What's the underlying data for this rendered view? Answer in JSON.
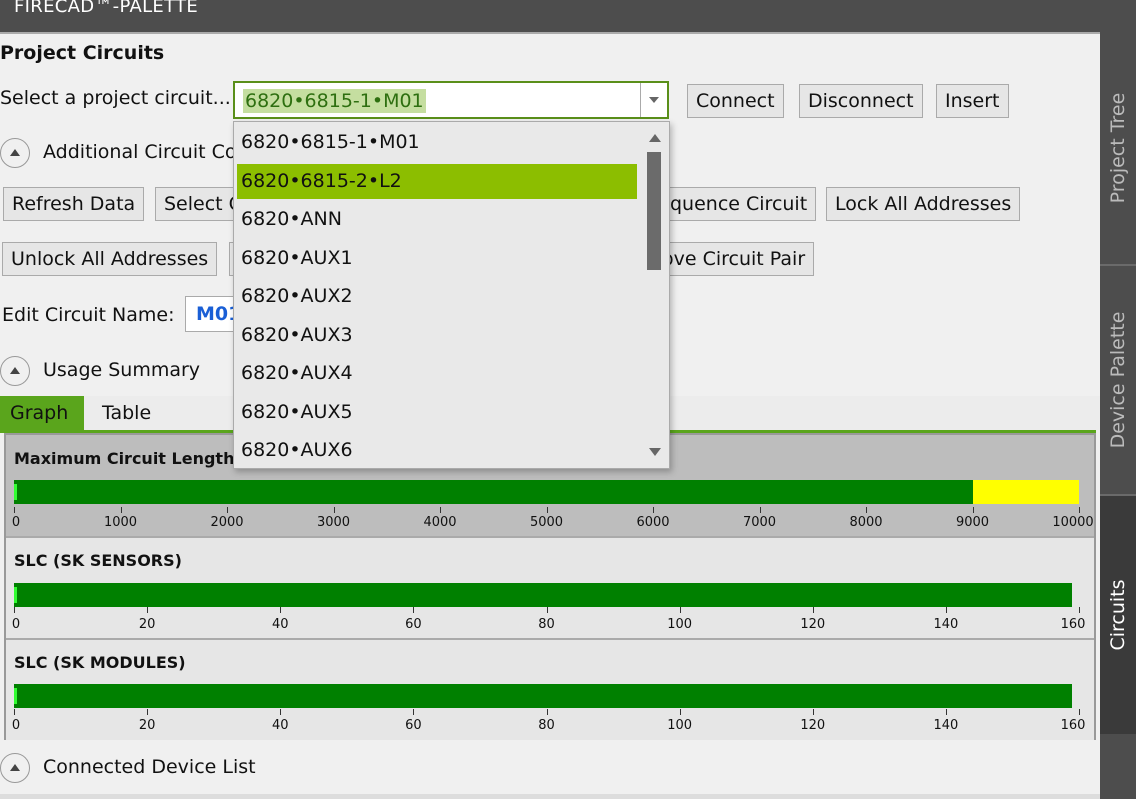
{
  "window": {
    "title": "FIRECAD™-PALETTE"
  },
  "side_tabs": [
    {
      "label": "Project Tree",
      "active": false
    },
    {
      "label": "Device Palette",
      "active": false
    },
    {
      "label": "Circuits",
      "active": true
    }
  ],
  "project": {
    "heading": "Project Circuits",
    "select_label": "Select a project circuit...",
    "selected_circuit": "6820•6815-1•M01",
    "buttons": {
      "connect": "Connect",
      "disconnect": "Disconnect",
      "insert": "Insert"
    }
  },
  "additional": {
    "label": "Additional Circuit Co",
    "buttons": {
      "refresh": "Refresh Data",
      "select": "Select C",
      "sequence": "quence Circuit",
      "lock_all": "Lock All Addresses",
      "unlock_all": "Unlock All Addresses",
      "remove_pair": "ove Circuit Pair"
    },
    "edit_name_label": "Edit Circuit Name:",
    "edit_name_value": "M01"
  },
  "usage_summary": {
    "label": "Usage Summary",
    "tabs": {
      "graph": "Graph",
      "table": "Table"
    }
  },
  "chart_data": [
    {
      "type": "bar",
      "title": "Maximum Circuit Length (F",
      "ticks": [
        "0",
        "1000",
        "2000",
        "3000",
        "4000",
        "5000",
        "6000",
        "7000",
        "8000",
        "9000",
        "10000"
      ],
      "xlim": [
        0,
        10000
      ],
      "segments": [
        {
          "from": 0,
          "to": 9000,
          "color": "#008000"
        },
        {
          "from": 9000,
          "to": 10000,
          "color": "#ffff00"
        }
      ],
      "used": 0
    },
    {
      "type": "bar",
      "title": "SLC (SK SENSORS)",
      "ticks": [
        "0",
        "20",
        "40",
        "60",
        "80",
        "100",
        "120",
        "140",
        "160"
      ],
      "xlim": [
        0,
        160
      ],
      "segments": [
        {
          "from": 0,
          "to": 159,
          "color": "#008000"
        }
      ],
      "used": 0
    },
    {
      "type": "bar",
      "title": "SLC (SK MODULES)",
      "ticks": [
        "0",
        "20",
        "40",
        "60",
        "80",
        "100",
        "120",
        "140",
        "160"
      ],
      "xlim": [
        0,
        160
      ],
      "segments": [
        {
          "from": 0,
          "to": 159,
          "color": "#008000"
        }
      ],
      "used": 0
    }
  ],
  "connected": {
    "label": "Connected Device List"
  },
  "dropdown": {
    "items": [
      "6820•6815-1•M01",
      "6820•6815-2•L2",
      "6820•ANN",
      "6820•AUX1",
      "6820•AUX2",
      "6820•AUX3",
      "6820•AUX4",
      "6820•AUX5",
      "6820•AUX6"
    ],
    "highlighted_index": 1
  },
  "colors": {
    "accent": "#5aa51c",
    "highlight": "#8cbe00",
    "bar_green": "#008000",
    "bar_yellow": "#ffff00",
    "name_blue": "#1a5fd6"
  }
}
